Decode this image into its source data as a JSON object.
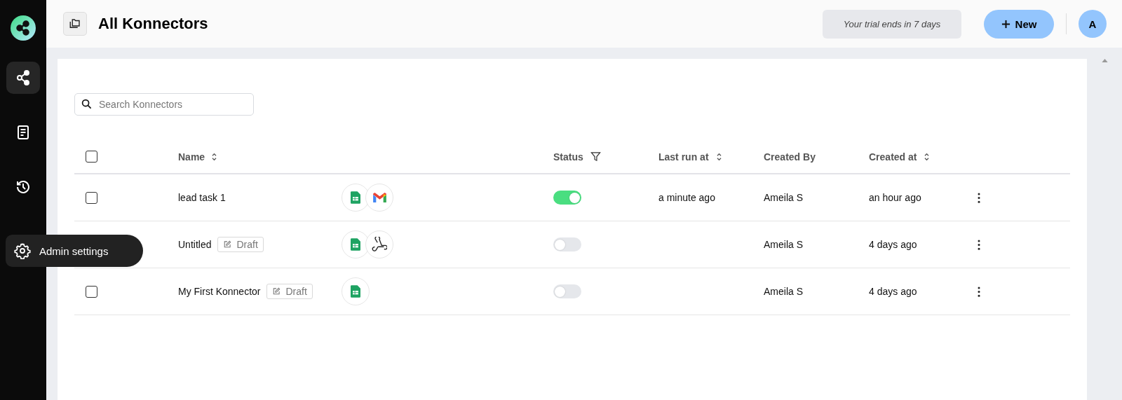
{
  "sidebar": {
    "items": [
      {
        "kind": "connectors",
        "selected": true
      },
      {
        "kind": "document",
        "selected": false
      },
      {
        "kind": "history",
        "selected": false
      }
    ],
    "tooltip": {
      "label": "Admin settings"
    }
  },
  "header": {
    "title": "All Konnectors",
    "trial": "Your trial ends in 7 days",
    "new_button": "New",
    "avatar": "A"
  },
  "search": {
    "placeholder": "Search Konnectors"
  },
  "table": {
    "columns": [
      {
        "label": "Name",
        "kind": "sort"
      },
      {
        "label": "Status",
        "kind": "filter"
      },
      {
        "label": "Last run at",
        "kind": "sort"
      },
      {
        "label": "Created By",
        "kind": "plain"
      },
      {
        "label": "Created at",
        "kind": "sort"
      }
    ],
    "header_checked": false,
    "rows": [
      {
        "checked": false,
        "name": "lead task 1",
        "apps": [
          {
            "kind": "sheets"
          },
          {
            "kind": "gmail"
          }
        ],
        "on": true,
        "last_run": "a minute ago",
        "created_by": "Ameila S",
        "created_at": "an hour ago"
      },
      {
        "name": "Untitled",
        "draft": "Draft",
        "apps": [
          {
            "kind": "sheets"
          },
          {
            "kind": "webhook"
          }
        ],
        "on": false,
        "created_by": "Ameila S",
        "created_at": "4 days ago"
      },
      {
        "checked": false,
        "name": "My First Konnector",
        "draft": "Draft",
        "apps": [
          {
            "kind": "sheets"
          }
        ],
        "on": false,
        "created_by": "Ameila S",
        "created_at": "4 days ago"
      }
    ]
  }
}
